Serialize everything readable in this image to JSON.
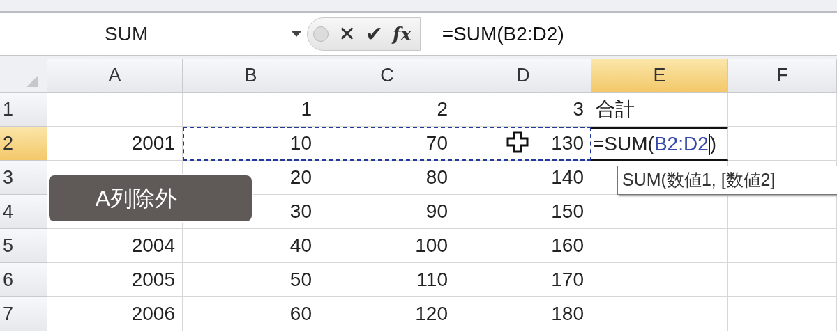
{
  "name_box": {
    "value": "SUM"
  },
  "formula_bar": {
    "cancel": "✕",
    "enter": "✔",
    "function": "fx",
    "formula": "=SUM(B2:D2)"
  },
  "columns": [
    {
      "label": "A",
      "selected": false
    },
    {
      "label": "B",
      "selected": false
    },
    {
      "label": "C",
      "selected": false
    },
    {
      "label": "D",
      "selected": false
    },
    {
      "label": "E",
      "selected": true
    },
    {
      "label": "F",
      "selected": false
    }
  ],
  "rows": [
    {
      "label": "1",
      "selected": false,
      "cells": [
        null,
        "1",
        "2",
        "3",
        "合計",
        null
      ]
    },
    {
      "label": "2",
      "selected": true,
      "cells": [
        "2001",
        "10",
        "70",
        "130",
        {
          "kind": "editor",
          "parts": [
            {
              "text": "=SUM(",
              "kind": "plain"
            },
            {
              "text": "B2:D2",
              "kind": "reference"
            },
            {
              "kind": "caret"
            },
            {
              "text": ")",
              "kind": "plain"
            }
          ]
        },
        null
      ]
    },
    {
      "label": "3",
      "selected": false,
      "cells": [
        null,
        "20",
        "80",
        "140",
        null,
        null
      ]
    },
    {
      "label": "4",
      "selected": false,
      "cells": [
        null,
        "30",
        "90",
        "150",
        null,
        null
      ]
    },
    {
      "label": "5",
      "selected": false,
      "cells": [
        "2004",
        "40",
        "100",
        "160",
        null,
        null
      ]
    },
    {
      "label": "6",
      "selected": false,
      "cells": [
        "2005",
        "50",
        "110",
        "170",
        null,
        null
      ]
    },
    {
      "label": "7",
      "selected": false,
      "cells": [
        "2006",
        "60",
        "120",
        "180",
        null,
        null
      ]
    }
  ],
  "tooltip": {
    "text": "SUM(数値1, [数値2]"
  },
  "caption": {
    "text": "A列除外"
  }
}
